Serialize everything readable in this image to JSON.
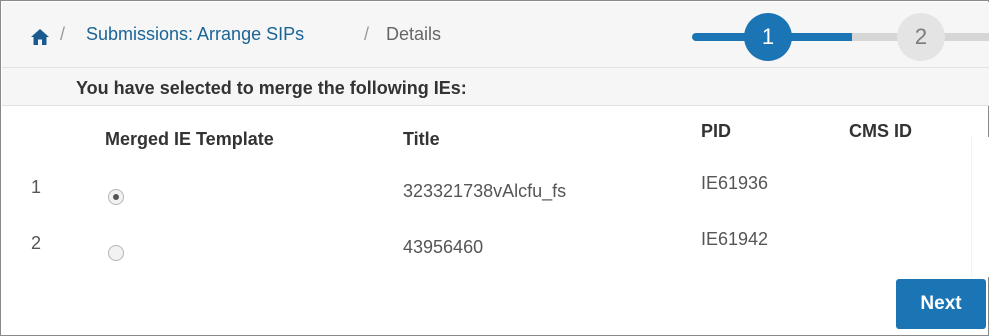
{
  "breadcrumb": {
    "home_icon": "home-icon",
    "separator": "/",
    "link_label": "Submissions: Arrange SIPs",
    "current_label": "Details"
  },
  "stepper": {
    "steps": [
      {
        "number": "1",
        "state": "active"
      },
      {
        "number": "2",
        "state": "inactive"
      }
    ],
    "active_color": "#1b75b5",
    "inactive_color": "#e4e4e4"
  },
  "subheader": {
    "text": "You have selected to merge the following IEs:"
  },
  "table": {
    "columns": [
      "Merged IE Template",
      "Title",
      "PID",
      "CMS ID"
    ],
    "rows": [
      {
        "index": "1",
        "selected": true,
        "title": "323321738vAlcfu_fs",
        "pid": "IE61936",
        "cms_id": ""
      },
      {
        "index": "2",
        "selected": false,
        "title": "43956460",
        "pid": "IE61942",
        "cms_id": ""
      }
    ]
  },
  "actions": {
    "next_label": "Next"
  },
  "colors": {
    "accent": "#1b75b5",
    "link": "#1a6496"
  }
}
